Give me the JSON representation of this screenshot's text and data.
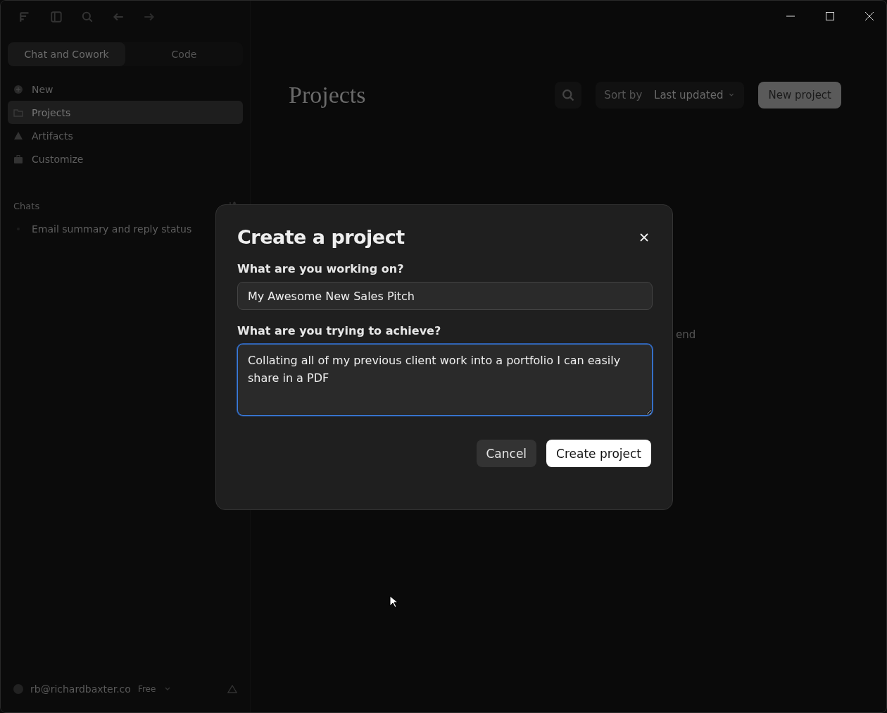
{
  "sidebar": {
    "modes": [
      {
        "label": "Chat and Cowork",
        "selected": true
      },
      {
        "label": "Code",
        "selected": false
      }
    ],
    "nav": [
      {
        "label": "New",
        "kind": "new",
        "selected": false
      },
      {
        "label": "Projects",
        "kind": "projects",
        "selected": true
      },
      {
        "label": "Artifacts",
        "kind": "artifacts",
        "selected": false
      },
      {
        "label": "Customize",
        "kind": "customize",
        "selected": false
      }
    ],
    "chats_heading": "Chats",
    "chats": [
      "Email summary and reply status"
    ],
    "account": {
      "email": "rb@richardbaxter.co",
      "plan": "Free"
    }
  },
  "main": {
    "title": "Projects",
    "sort": {
      "prefix": "Sort by",
      "value": "Last updated"
    },
    "new_button": "New project",
    "hidden_text": "end"
  },
  "dialog": {
    "title": "Create a project",
    "fields": [
      {
        "label": "What are you working on?",
        "kind": "input",
        "value": "My Awesome New Sales Pitch",
        "focused": false
      },
      {
        "label": "What are you trying to achieve?",
        "kind": "textarea",
        "value": "Collating all of my previous client work into a portfolio I can easily share in a PDF",
        "focused": true
      }
    ],
    "buttons": [
      {
        "label": "Cancel",
        "kind": "secondary"
      },
      {
        "label": "Create project",
        "kind": "primary"
      }
    ]
  }
}
